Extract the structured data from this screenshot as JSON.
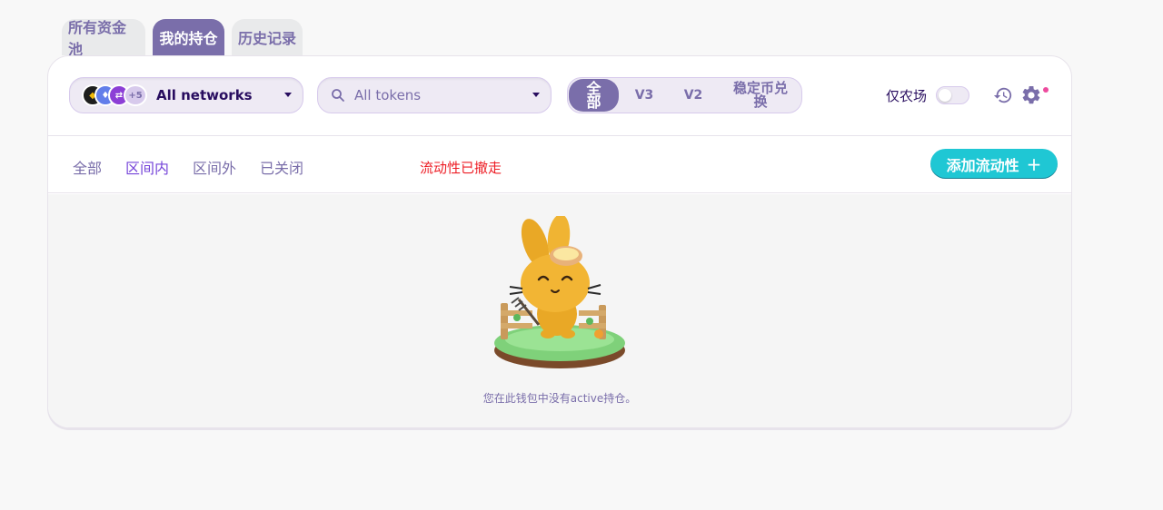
{
  "tabs": [
    {
      "label": "所有资金池",
      "active": false
    },
    {
      "label": "我的持仓",
      "active": true
    },
    {
      "label": "历史记录",
      "active": false
    }
  ],
  "toolbar": {
    "network_select": {
      "label": "All networks",
      "icons": [
        "bnb-chain-icon",
        "ethereum-icon",
        "zksync-icon"
      ],
      "more_count": "+5"
    },
    "token_select": {
      "label": "All tokens",
      "icon": "search-icon"
    },
    "protocol_segments": [
      {
        "label": "全部",
        "active": true
      },
      {
        "label": "V3",
        "active": false
      },
      {
        "label": "V2",
        "active": false
      },
      {
        "label": "稳定币兑换",
        "active": false
      }
    ],
    "farms_only": {
      "label": "仅农场",
      "checked": false
    },
    "history_icon": "history-icon",
    "settings_icon": "gear-icon"
  },
  "filters": {
    "items": [
      {
        "label": "全部",
        "active": false
      },
      {
        "label": "区间内",
        "active": true
      },
      {
        "label": "区间外",
        "active": false
      },
      {
        "label": "已关闭",
        "active": false
      }
    ],
    "notice": "流动性已撤走",
    "add_liquidity_label": "添加流动性"
  },
  "empty_state": {
    "message": "您在此钱包中没有active持仓。"
  },
  "colors": {
    "primary": "#7a6eaa",
    "accent": "#1fc7d4",
    "active_filter": "#7645d9",
    "notice": "#ed1c24",
    "text": "#280d5f"
  }
}
